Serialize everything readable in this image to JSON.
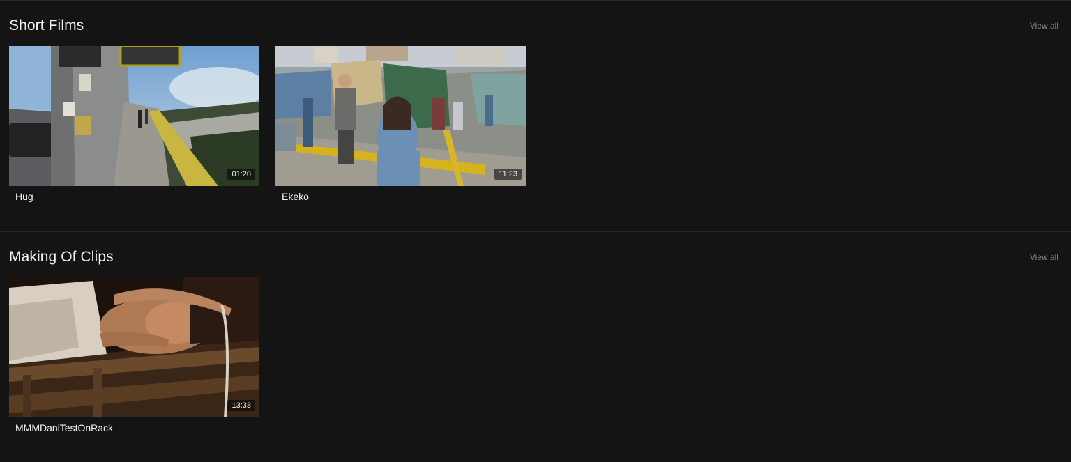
{
  "sections": [
    {
      "title": "Short Films",
      "view_all_label": "View all",
      "videos": [
        {
          "title": "Hug",
          "duration": "01:20"
        },
        {
          "title": "Ekeko",
          "duration": "11:23"
        }
      ]
    },
    {
      "title": "Making Of Clips",
      "view_all_label": "View all",
      "videos": [
        {
          "title": "MMMDaniTestOnRack",
          "duration": "13:33"
        }
      ]
    }
  ],
  "colors": {
    "background": "#141414",
    "divider": "#262626",
    "muted_text": "#8a8a8a"
  }
}
